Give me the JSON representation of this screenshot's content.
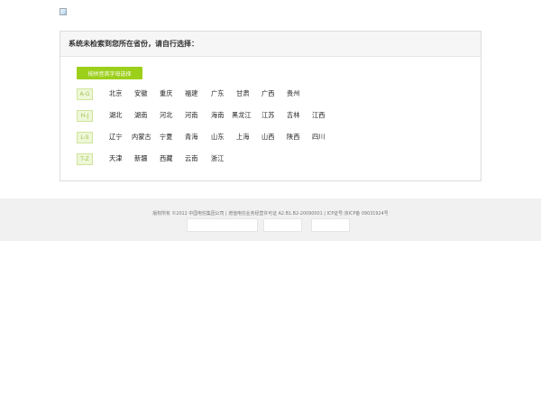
{
  "logo": {
    "icon": "broken-image-icon"
  },
  "panel": {
    "header": "系统未检索到您所在省份，请自行选择：",
    "button_label": "按拼音首字母选择",
    "groups": [
      {
        "label": "A-G",
        "provinces": [
          "北京",
          "安徽",
          "重庆",
          "福建",
          "广东",
          "甘肃",
          "广西",
          "贵州"
        ]
      },
      {
        "label": "H-J",
        "provinces": [
          "湖北",
          "湖南",
          "河北",
          "河南",
          "海南",
          "黑龙江",
          "江苏",
          "吉林",
          "江西"
        ]
      },
      {
        "label": "L-S",
        "provinces": [
          "辽宁",
          "内蒙古",
          "宁夏",
          "青海",
          "山东",
          "上海",
          "山西",
          "陕西",
          "四川"
        ]
      },
      {
        "label": "T-Z",
        "provinces": [
          "天津",
          "新疆",
          "西藏",
          "云南",
          "浙江"
        ]
      }
    ]
  },
  "footer": {
    "copyright": "版权所有 ©2012 中国电信集团公司 | 增值电信业务经营许可证 A2.B1.B2-20090001 | ICP证号:京ICP备 09031924号"
  },
  "colors": {
    "accent": "#9ccf1a",
    "badge_bg": "#eef7d8",
    "badge_text": "#9fbf4b"
  }
}
